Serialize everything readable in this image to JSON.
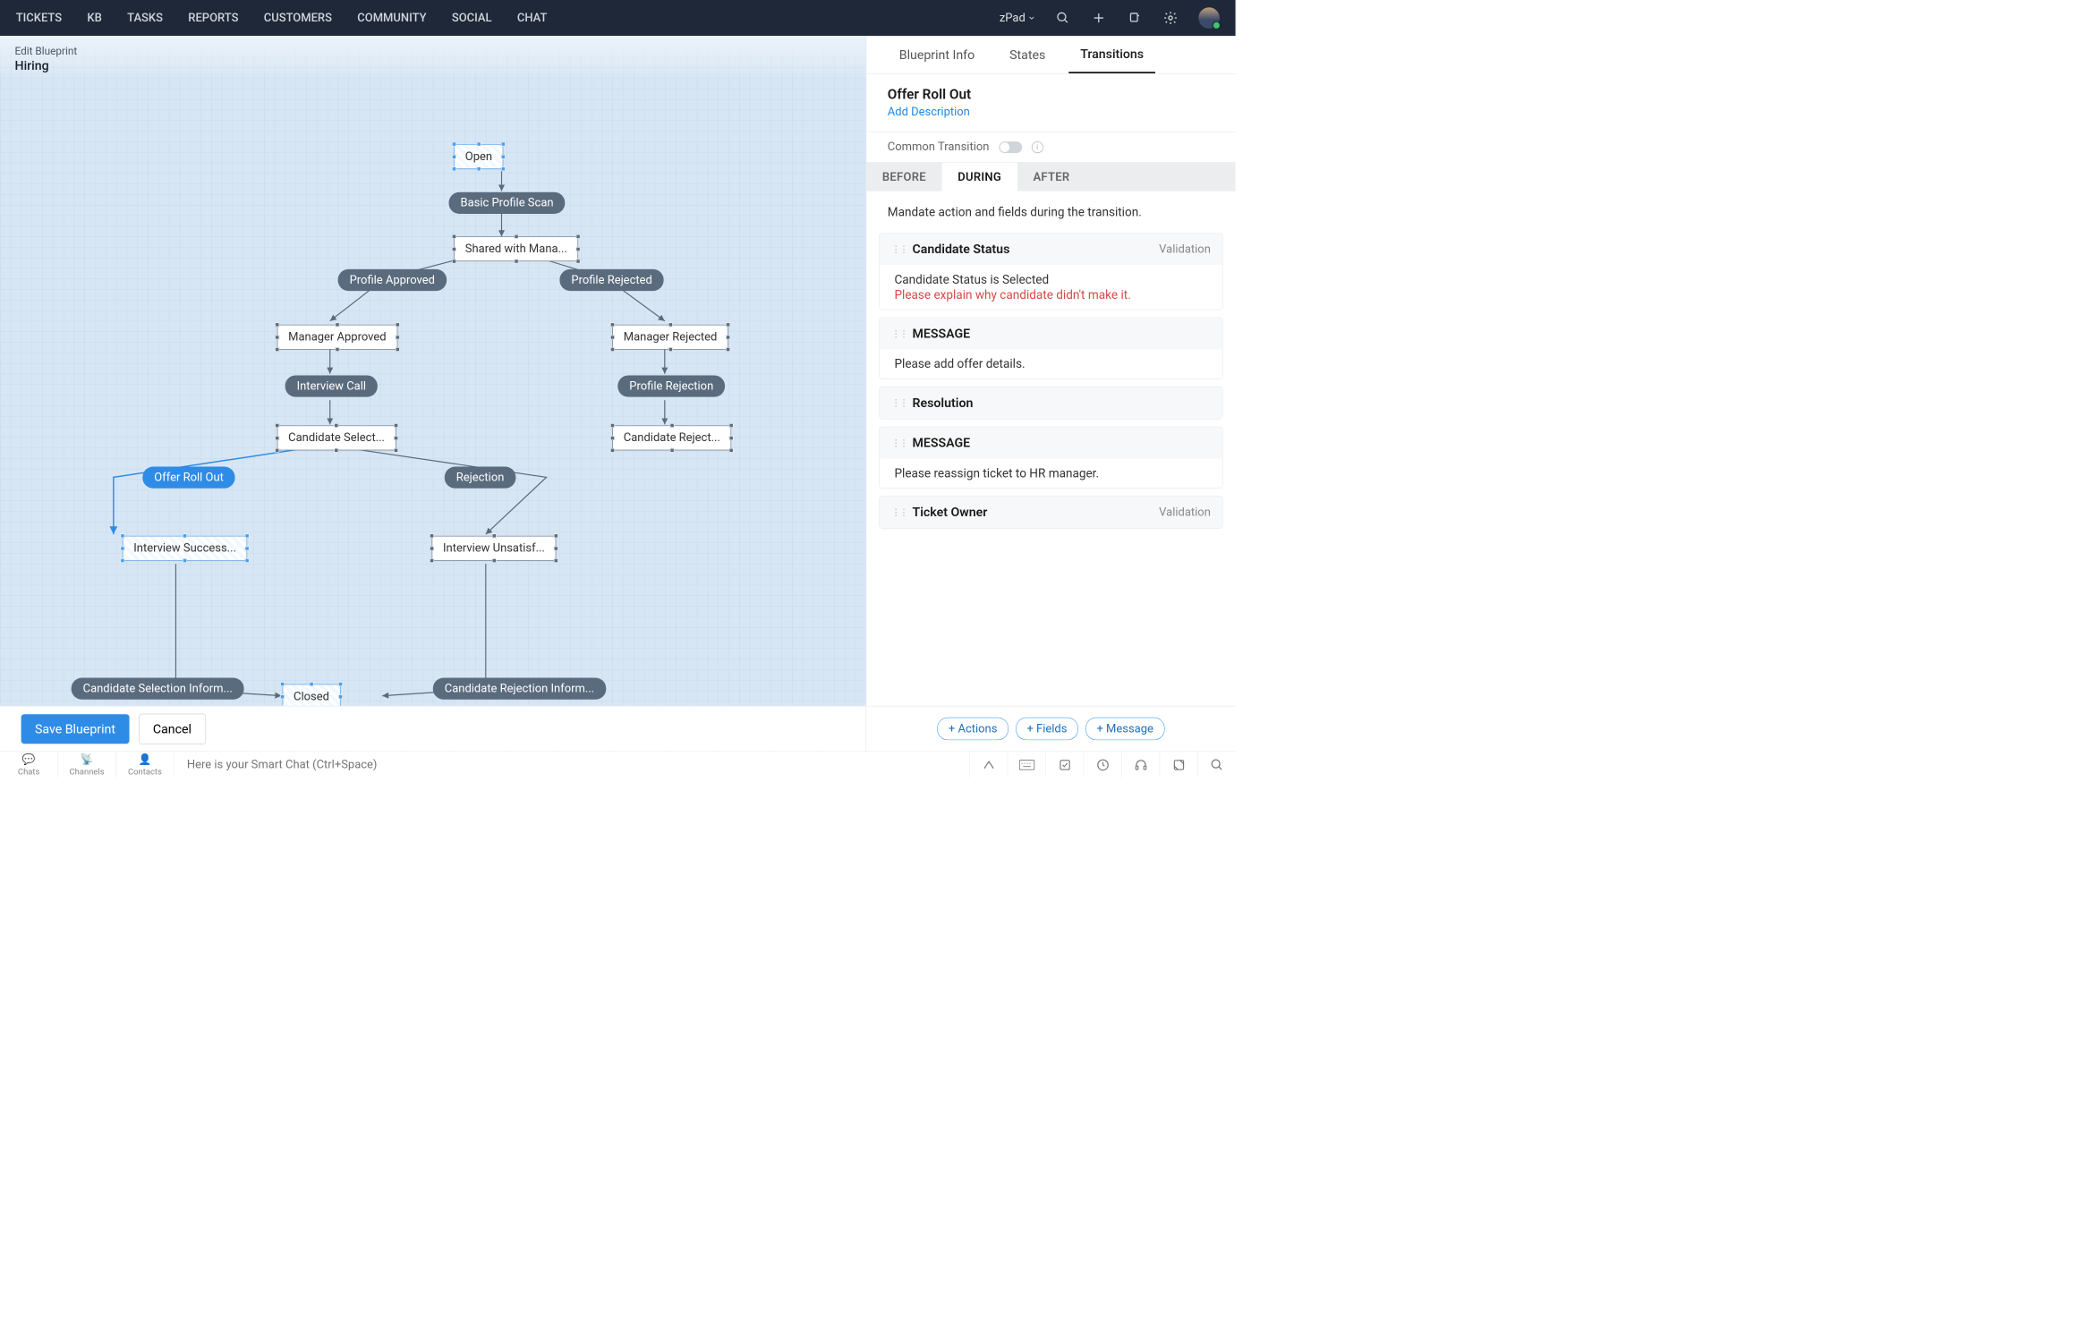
{
  "nav": {
    "items": [
      "TICKETS",
      "KB",
      "TASKS",
      "REPORTS",
      "CUSTOMERS",
      "COMMUNITY",
      "SOCIAL",
      "CHAT"
    ],
    "brand": "zPad"
  },
  "header": {
    "crumb": "Edit Blueprint",
    "title": "Hiring"
  },
  "nodes": {
    "open": "Open",
    "shared": "Shared with Mana...",
    "mgr_app": "Manager Approved",
    "mgr_rej": "Manager Rejected",
    "cand_sel": "Candidate Select...",
    "cand_rej": "Candidate Reject...",
    "int_succ": "Interview Success...",
    "int_unsat": "Interview Unsatisf...",
    "closed": "Closed"
  },
  "pills": {
    "basic_scan": "Basic Profile Scan",
    "prof_app": "Profile Approved",
    "prof_rej": "Profile Rejected",
    "int_call": "Interview Call",
    "prof_rejection": "Profile Rejection",
    "offer": "Offer Roll Out",
    "rejection": "Rejection",
    "sel_inform": "Candidate Selection Inform...",
    "rej_inform": "Candidate Rejection Inform..."
  },
  "panel": {
    "tabs": [
      "Blueprint Info",
      "States",
      "Transitions"
    ],
    "title": "Offer Roll Out",
    "add_desc": "Add Description",
    "common": "Common Transition",
    "sub_tabs": [
      "BEFORE",
      "DURING",
      "AFTER"
    ],
    "mandate": "Mandate action and fields during the transition.",
    "cards": [
      {
        "label": "Candidate Status",
        "badge": "Validation",
        "status_prefix": "Candidate Status is",
        "status_value": "Selected",
        "error": "Please explain why candidate didn't make it."
      },
      {
        "label": "MESSAGE",
        "body": "Please add offer details."
      },
      {
        "label": "Resolution"
      },
      {
        "label": "MESSAGE",
        "body": "Please reassign ticket to HR manager."
      },
      {
        "label": "Ticket Owner",
        "badge": "Validation"
      }
    ],
    "chips": [
      "+ Actions",
      "+ Fields",
      "+ Message"
    ]
  },
  "buttons": {
    "save": "Save Blueprint",
    "cancel": "Cancel"
  },
  "footer": {
    "tabs": [
      "Chats",
      "Channels",
      "Contacts"
    ],
    "placeholder": "Here is your Smart Chat (Ctrl+Space)"
  }
}
